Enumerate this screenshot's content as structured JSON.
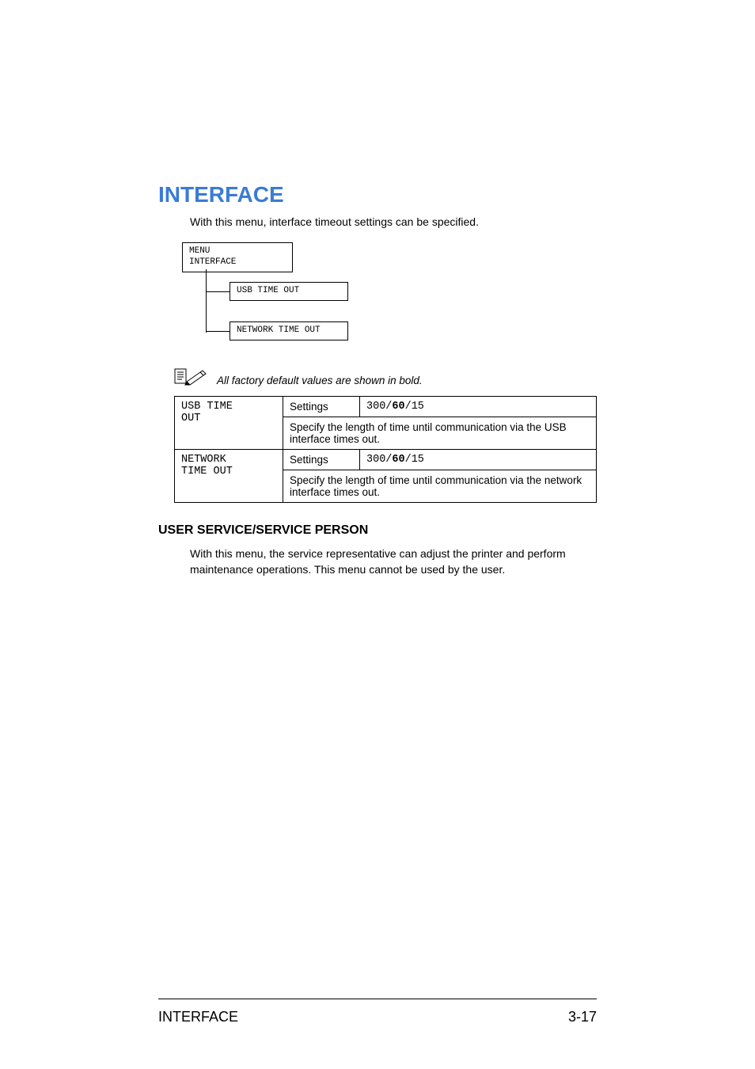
{
  "section_title": "INTERFACE",
  "intro": "With this menu, interface timeout settings can be specified.",
  "menu_tree": {
    "root_line1": "MENU",
    "root_line2": "INTERFACE",
    "child1": "USB TIME OUT",
    "child2": "NETWORK TIME OUT"
  },
  "note": "All factory default values are shown in bold.",
  "settings_table": {
    "rows": [
      {
        "key_line1": "USB TIME",
        "key_line2": "OUT",
        "settings_label": "Settings",
        "value_pre": "300/",
        "value_bold": "60",
        "value_post": "/15",
        "desc": "Specify the length of time until communication via the USB interface times out."
      },
      {
        "key_line1": "NETWORK",
        "key_line2": "TIME OUT",
        "settings_label": "Settings",
        "value_pre": "300/",
        "value_bold": "60",
        "value_post": "/15",
        "desc": "Specify the length of time until communication via the network interface times out."
      }
    ]
  },
  "subsection_title": "USER SERVICE/SERVICE PERSON",
  "subsection_text": "With this menu, the service representative can adjust the printer and perform maintenance operations. This menu cannot be used by the user.",
  "footer_left": "INTERFACE",
  "footer_right": "3-17"
}
